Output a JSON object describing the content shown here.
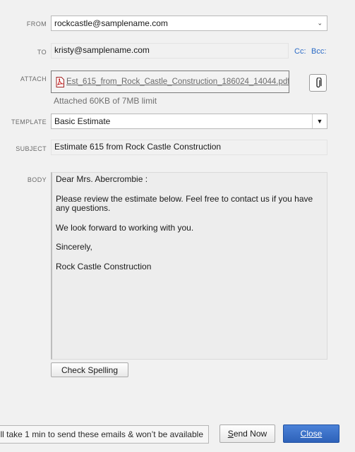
{
  "form": {
    "from": {
      "label": "FROM",
      "value": "rockcastle@samplename.com"
    },
    "to": {
      "label": "TO",
      "value": "kristy@samplename.com",
      "cc_label": "Cc:",
      "bcc_label": "Bcc:"
    },
    "attach": {
      "label": "ATTACH",
      "file_name": "Est_615_from_Rock_Castle_Construction_186024_14044.pdf",
      "limit_text": "Attached 60KB of 7MB limit"
    },
    "template": {
      "label": "TEMPLATE",
      "value": "Basic Estimate"
    },
    "subject": {
      "label": "SUBJECT",
      "value": "Estimate 615 from Rock Castle Construction"
    },
    "body": {
      "label": "BODY",
      "greeting": "Dear Mrs. Abercrombie :",
      "line1": "Please review the estimate below.  Feel free to contact us if you have any questions.",
      "line2": "We look forward to working with you.",
      "closing": "Sincerely,",
      "signature": "Rock Castle Construction"
    }
  },
  "buttons": {
    "check_spelling": "Check Spelling",
    "send_now_first": "S",
    "send_now_rest": "end Now",
    "close_first": "C",
    "close_rest": "lose"
  },
  "footer": {
    "notice": "ll take 1 min to send these emails & won’t be available"
  },
  "colors": {
    "link": "#2a6ac6",
    "primary_button": "#2e62b9",
    "background": "#f1f1f1"
  }
}
